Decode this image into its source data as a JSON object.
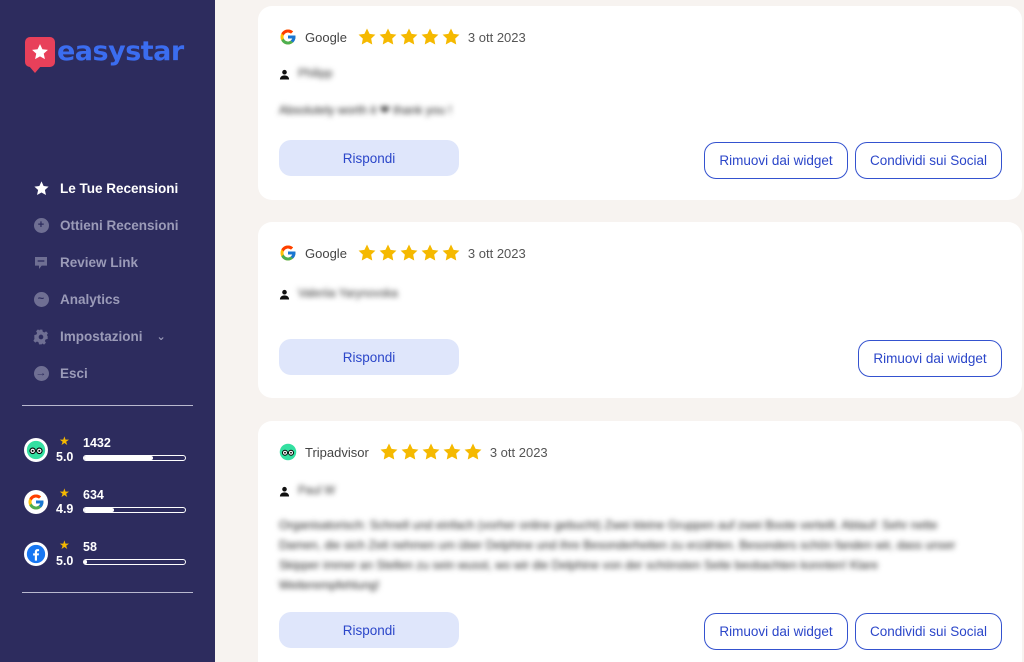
{
  "app": {
    "logo_text": "easystar"
  },
  "sidebar": {
    "nav": [
      {
        "label": "Le Tue Recensioni",
        "icon": "star-icon",
        "active": true
      },
      {
        "label": "Ottieni Recensioni",
        "icon": "plus-circle-icon"
      },
      {
        "label": "Review Link",
        "icon": "chat-icon"
      },
      {
        "label": "Analytics",
        "icon": "trend-icon"
      },
      {
        "label": "Impostazioni",
        "icon": "gear-icon"
      },
      {
        "label": "Esci",
        "icon": "logout-icon"
      }
    ],
    "stats": [
      {
        "platform": "Tripadvisor",
        "rating": "5.0",
        "count": "1432",
        "progress": 0.68
      },
      {
        "platform": "Google",
        "rating": "4.9",
        "count": "634",
        "progress": 0.3
      },
      {
        "platform": "Facebook",
        "rating": "5.0",
        "count": "58",
        "progress": 0.03
      }
    ]
  },
  "reviews": [
    {
      "source": "Google",
      "stars": 5,
      "date": "3 ott 2023",
      "reviewer": "Philipp",
      "text": "Absolutely worth it ❤ thank you !",
      "reply_label": "Rispondi",
      "remove_label": "Rimuovi dai widget",
      "share_label": "Condividi sui Social"
    },
    {
      "source": "Google",
      "stars": 5,
      "date": "3 ott 2023",
      "reviewer": "Valeriia Yarynovska",
      "text": "",
      "reply_label": "Rispondi",
      "remove_label": "Rimuovi dai widget"
    },
    {
      "source": "Tripadvisor",
      "stars": 5,
      "date": "3 ott 2023",
      "reviewer": "Paul W",
      "text": "Organisatorisch: Schnell und einfach (vorher online gebucht) Zwei kleine Gruppen auf zwei Boote verteilt. Ablauf: Sehr nette Damen, die sich Zeit nehmen um über Delphine und ihre Besonderheiten zu erzählen. Besonders schön fanden wir, dass unser Skipper immer an Stellen zu sein wusst, wo wir die Delphine von der schönsten Seite beobachten konnten! Klare Weiterempfehlung!",
      "reply_label": "Rispondi",
      "remove_label": "Rimuovi dai widget",
      "share_label": "Condividi sui Social"
    }
  ],
  "colors": {
    "sidebar_bg": "#2d2c5e",
    "accent": "#3452cf",
    "star": "#f5b900",
    "brand_red": "#e8405a"
  }
}
